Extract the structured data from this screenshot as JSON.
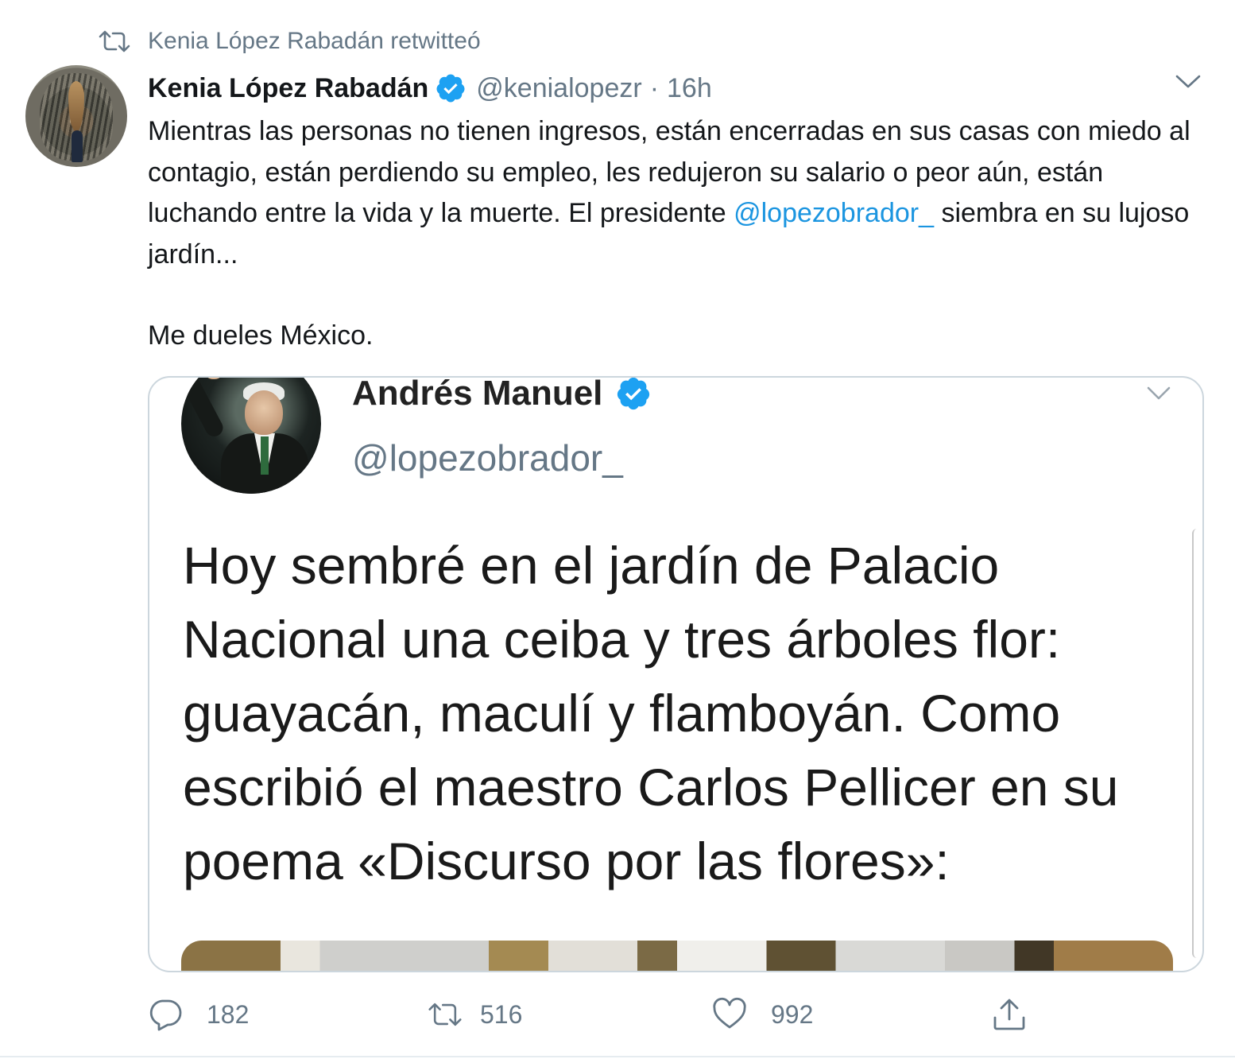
{
  "retweet_context": {
    "text": "Kenia López Rabadán retwitteó",
    "icon": "retweet-icon"
  },
  "author": {
    "name": "Kenia López Rabadán",
    "handle": "@kenialopezr",
    "separator": "·",
    "time": "16h",
    "verified": true
  },
  "tweet": {
    "text_part1": "Mientras las personas no tienen ingresos,  están encerradas en sus casas con miedo al contagio, están perdiendo su empleo, les redujeron su salario o peor aún, están luchando entre la vida y la muerte. El presidente ",
    "mention": "@lopezobrador_",
    "text_part2": " siembra en su lujoso jardín...",
    "paragraph2": "Me dueles México."
  },
  "media": {
    "name": "Andrés Manuel",
    "handle": "@lopezobrador_",
    "text": "Hoy sembré en el jardín de Palacio Nacional una ceiba y tres árboles flor: guayacán, maculí y flamboyán. Como escribió el maestro Carlos Pellicer en su poema «Discurso por las flores»:"
  },
  "actions": {
    "replies": "182",
    "retweets": "516",
    "likes": "992"
  },
  "colors": {
    "link": "#1b95e0",
    "verified": "#1da1f2",
    "secondary_text": "#657786",
    "border": "#ccd6dd"
  }
}
